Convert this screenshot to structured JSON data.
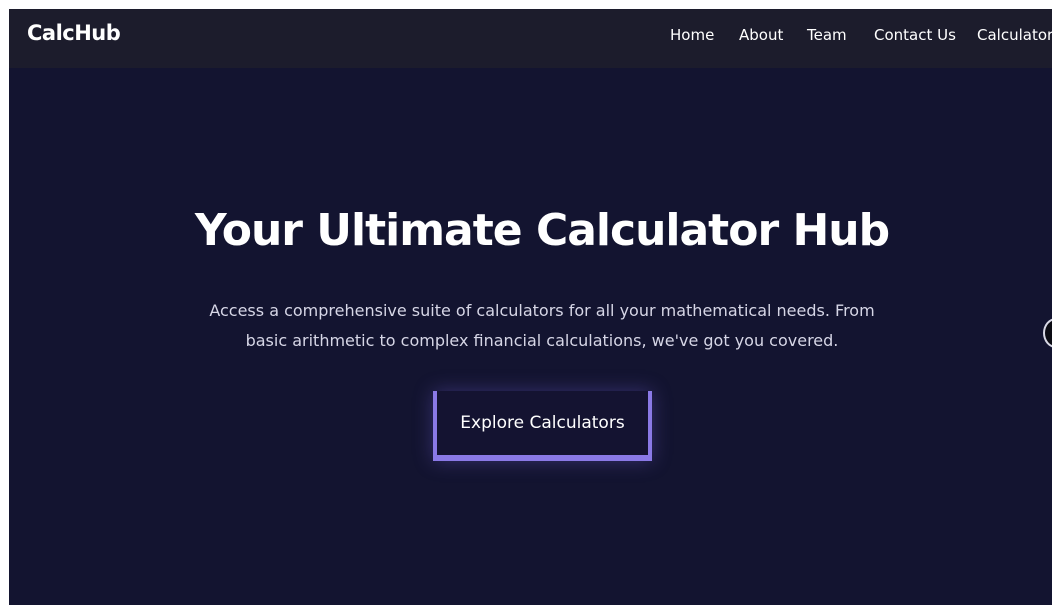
{
  "navbar": {
    "brand": "CalcHub",
    "links": [
      {
        "label": "Home"
      },
      {
        "label": "About"
      },
      {
        "label": "Team"
      },
      {
        "label": "Contact Us"
      },
      {
        "label": "Calculators"
      }
    ]
  },
  "hero": {
    "title": "Your Ultimate Calculator Hub",
    "subtitle": "Access a comprehensive suite of calculators for all your mathematical needs. From basic arithmetic to complex financial calculations, we've got you covered.",
    "cta_label": "Explore Calculators"
  },
  "colors": {
    "page_background": "#131430",
    "navbar_background": "#1c1c2c",
    "accent": "#8a79e6"
  }
}
